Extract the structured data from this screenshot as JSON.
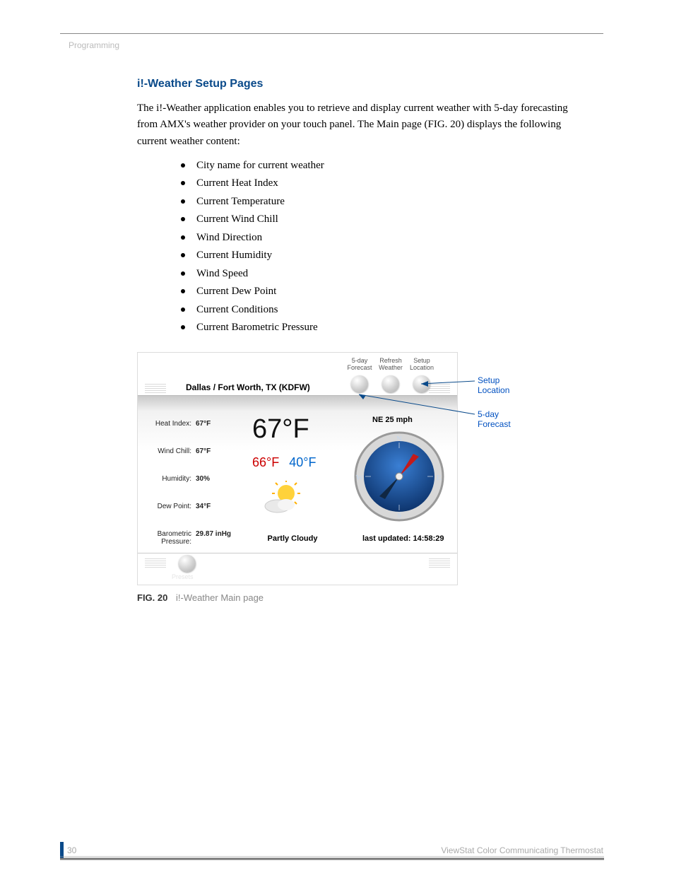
{
  "sectionLabel": "Programming",
  "heading": "i!-Weather Setup Pages",
  "intro": "The i!-Weather application enables you to retrieve and display current weather with 5-day forecasting from AMX's weather provider on your touch panel. The Main page (FIG. 20) displays the following current weather content:",
  "bullets": [
    "City name for current weather",
    "Current Heat Index",
    "Current Temperature",
    "Current Wind Chill",
    "Wind Direction",
    "Current Humidity",
    "Wind Speed",
    "Current Dew Point",
    "Current Conditions",
    "Current Barometric Pressure"
  ],
  "screenshot": {
    "city": "Dallas / Fort Worth, TX (KDFW)",
    "topButtons": {
      "forecast": "5-day\nForecast",
      "refresh": "Refresh\nWeather",
      "setup": "Setup\nLocation"
    },
    "stats": {
      "heatIndexLabel": "Heat Index:",
      "heatIndex": "67°F",
      "windChillLabel": "Wind Chill:",
      "windChill": "67°F",
      "humidityLabel": "Humidity:",
      "humidity": "30%",
      "dewPointLabel": "Dew Point:",
      "dewPoint": "34°F",
      "baroLabel": "Barometric\nPressure:",
      "baro": "29.87 inHg"
    },
    "currentTemp": "67°F",
    "hi": "66°F",
    "lo": "40°F",
    "condition": "Partly Cloudy",
    "wind": "NE 25 mph",
    "lastUpdated": "last updated: 14:58:29",
    "presetsLabel": "Presets"
  },
  "callouts": {
    "setupLocation": "Setup Location",
    "fiveDay": "5-day Forecast"
  },
  "caption": {
    "figNum": "FIG. 20",
    "figText": "i!-Weather Main page"
  },
  "pageNumber": "30",
  "footerTitle": "ViewStat Color Communicating Thermostat"
}
